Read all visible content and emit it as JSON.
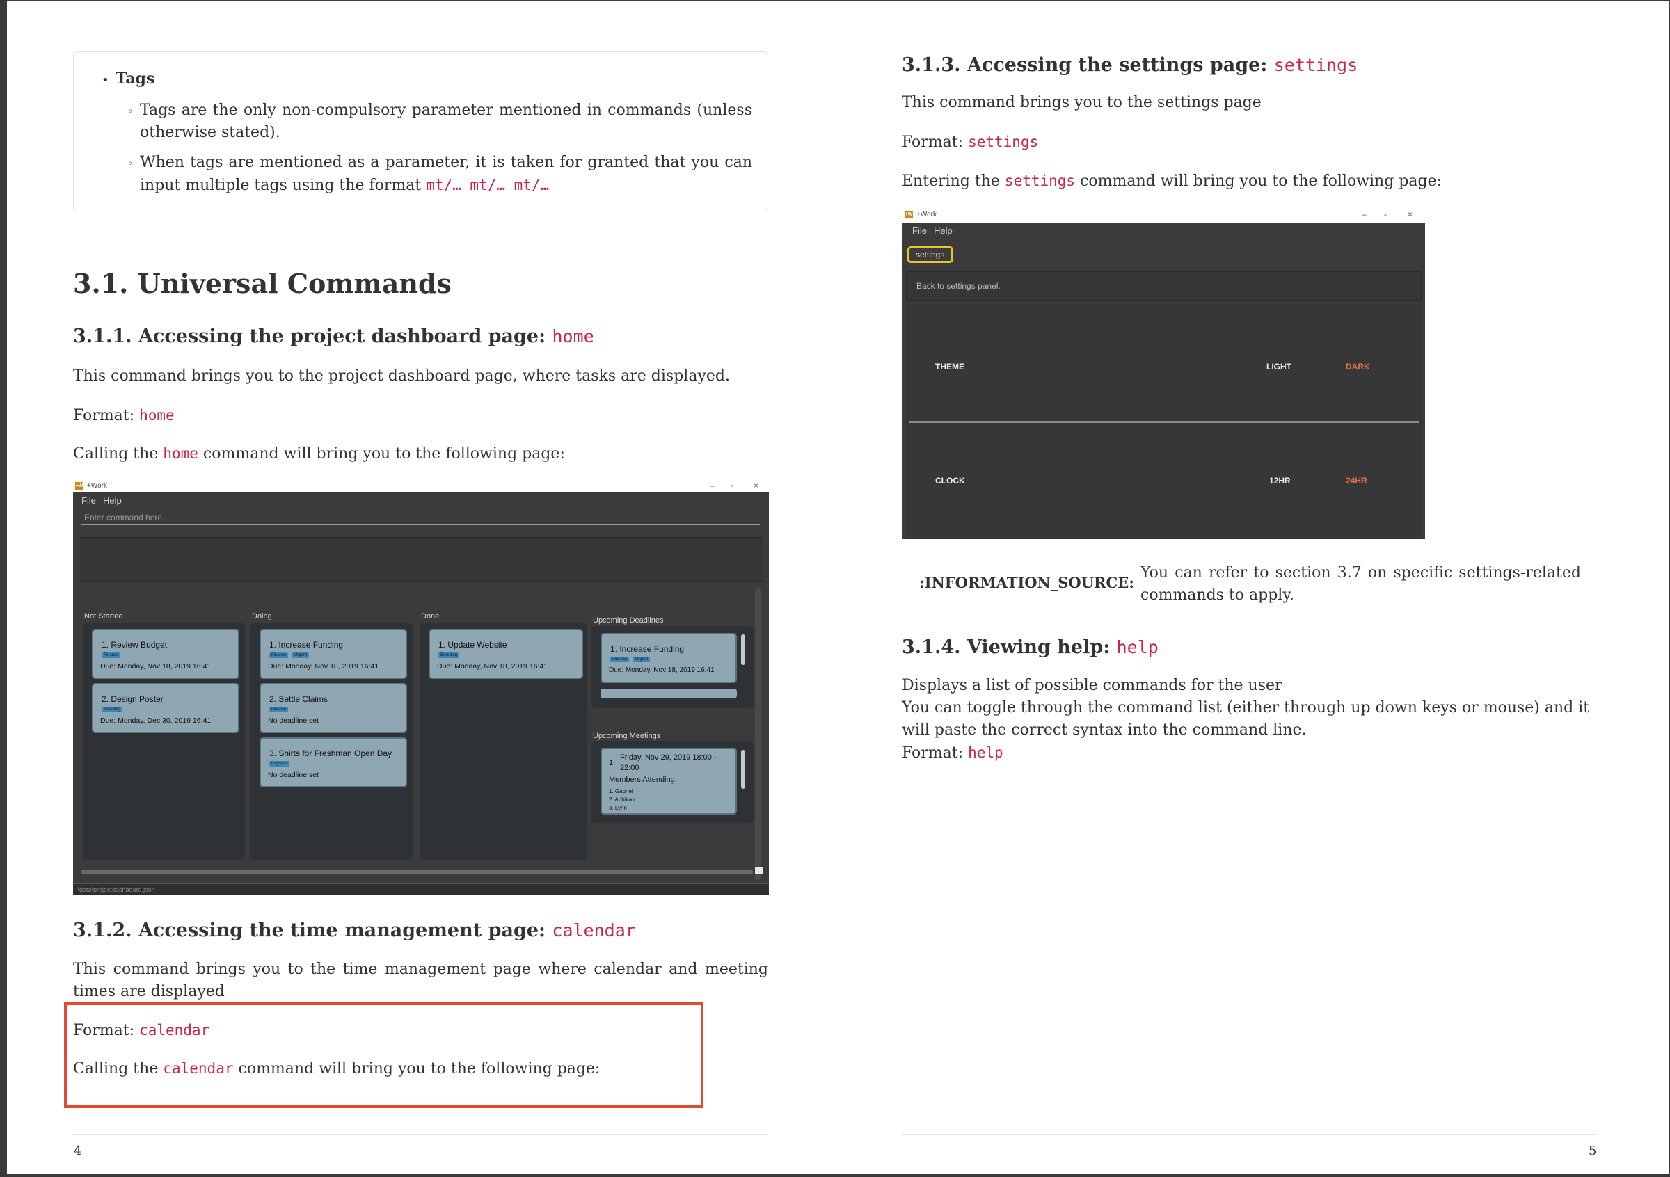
{
  "tags": {
    "title": "Tags",
    "item1": "Tags are the only non-compulsory parameter mentioned in commands (unless otherwise stated).",
    "item2_prefix": "When tags are mentioned as a parameter, it is taken for granted that you can input multiple tags using the format",
    "item2_code": "mt/… mt/… mt/…"
  },
  "section": {
    "title": "3.1. Universal Commands"
  },
  "home": {
    "heading": "3.1.1. Accessing the project dashboard page:",
    "heading_code": "home",
    "desc": "This command brings you to the project dashboard page, where tasks are displayed.",
    "format_label": "Format:",
    "format_code": "home",
    "calling_pre": "Calling the",
    "calling_code": "home",
    "calling_post": "command will bring you to the following page:"
  },
  "dash": {
    "window_title": "+Work",
    "app_icon": "+W",
    "menu_file": "File",
    "menu_help": "Help",
    "command_placeholder": "Enter command here...",
    "col_not_started": "Not Started",
    "col_doing": "Doing",
    "col_done": "Done",
    "col_upcoming_deadlines": "Upcoming Deadlines",
    "col_upcoming_meetings": "Upcoming Meetings",
    "card1_title": "1.  Review Budget",
    "card1_tag": "Finance",
    "card1_due": "Due: Monday, Nov 18, 2019 16:41",
    "card2_title": "2.  Design Poster",
    "card2_tag": "Branding",
    "card2_due": "Due: Monday, Dec 30, 2019 16:41",
    "card3_title": "1.  Increase Funding",
    "card3_tag1": "Finance",
    "card3_tag2": "Urgent",
    "card3_due": "Due: Monday, Nov 18, 2019 16:41",
    "card4_title": "2.  Settle Claims",
    "card4_tag": "Finance",
    "card4_due": "No deadline set",
    "card5_title": "3.  Shirts for Freshman Open Day",
    "card5_tag": "Logistics",
    "card5_due": "No deadline set",
    "card6_title": "1.  Update Website",
    "card6_tag": "Branding",
    "card6_due": "Due: Monday, Nov 18, 2019 16:41",
    "card7_title": "1.  Increase Funding",
    "card7_tag1": "Finance",
    "card7_tag2": "Urgent",
    "card7_due": "Due: Monday, Nov 18, 2019 16:41",
    "meeting_num": "1.",
    "meeting_time1": "Friday, Nov 29, 2019 18:00 -",
    "meeting_time2": "22:00",
    "meeting_members": "Members Attending:",
    "member1": "1. Gabriel",
    "member2": "2. Abhinav",
    "member3": "3. Lynn",
    "status_path": ".\\data\\projectdashboard.json"
  },
  "calendar": {
    "heading": "3.1.2. Accessing the time management page:",
    "heading_code": "calendar",
    "desc": "This command brings you to the time management page where calendar and meeting times are displayed",
    "format_label": "Format:",
    "format_code": "calendar",
    "calling_pre": "Calling the",
    "calling_code": "calendar",
    "calling_post": "command will bring you to the following page:"
  },
  "settings": {
    "heading": "3.1.3. Accessing the settings page:",
    "heading_code": "settings",
    "desc": "This command brings you to the settings page",
    "format_label": "Format:",
    "format_code": "settings",
    "entering_pre": "Entering the",
    "entering_code": "settings",
    "entering_post": "command will bring you to the following page:"
  },
  "settings_app": {
    "window_title": "+Work",
    "app_icon": "+W",
    "menu_file": "File",
    "menu_help": "Help",
    "command_value": "settings",
    "result": "Back to settings panel.",
    "theme_label": "THEME",
    "theme_light": "LIGHT",
    "theme_dark": "DARK",
    "clock_label": "CLOCK",
    "clock_12": "12HR",
    "clock_24": "24HR"
  },
  "info": {
    "label": ":INFORMATION_SOURCE:",
    "text": "You can refer to section 3.7 on specific settings-related commands to apply."
  },
  "help": {
    "heading": "3.1.4. Viewing help:",
    "heading_code": "help",
    "line1": "Displays a list of possible commands for the user",
    "line2": "You can toggle through the command list (either through up down keys or mouse) and it will paste the correct syntax into the command line.",
    "format_label": "Format:",
    "format_code": "help"
  },
  "footer": {
    "left_page": "4",
    "right_page": "5"
  },
  "colors": {
    "code": "#c7254e",
    "highlight_box": "#e04a2f",
    "accent_orange": "#e8734a"
  }
}
